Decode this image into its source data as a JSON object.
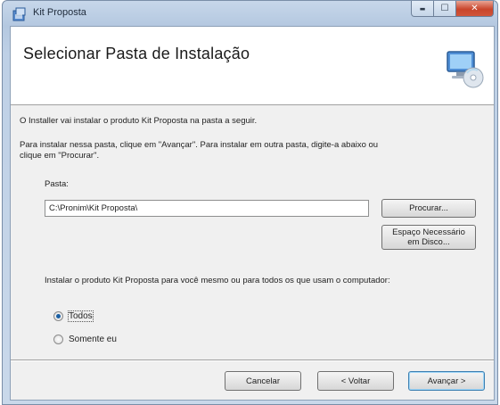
{
  "window": {
    "title": "Kit Proposta",
    "controls": {
      "minimize": "▬",
      "maximize": "☐",
      "close": "✕"
    }
  },
  "header": {
    "title": "Selecionar Pasta de Instalação",
    "icon": "computer-disc-icon"
  },
  "body": {
    "intro": "O Installer vai instalar o produto Kit Proposta na pasta a seguir.",
    "instructions_line1": "Para instalar nessa pasta, clique em \"Avançar\". Para instalar em outra pasta, digite-a abaixo ou",
    "instructions_line2": "clique em \"Procurar\"."
  },
  "folder": {
    "label": "Pasta:",
    "value": "C:\\Pronim\\Kit Proposta\\"
  },
  "buttons": {
    "browse": "Procurar...",
    "disk_space": "Espaço Necessário em Disco..."
  },
  "install_for": {
    "question": "Instalar o produto Kit Proposta para você mesmo ou para todos os que usam o computador:",
    "options": [
      {
        "label": "Todos",
        "selected": true
      },
      {
        "label": "Somente eu",
        "selected": false
      }
    ]
  },
  "footer": {
    "cancel": "Cancelar",
    "back": "< Voltar",
    "next": "Avançar >"
  }
}
